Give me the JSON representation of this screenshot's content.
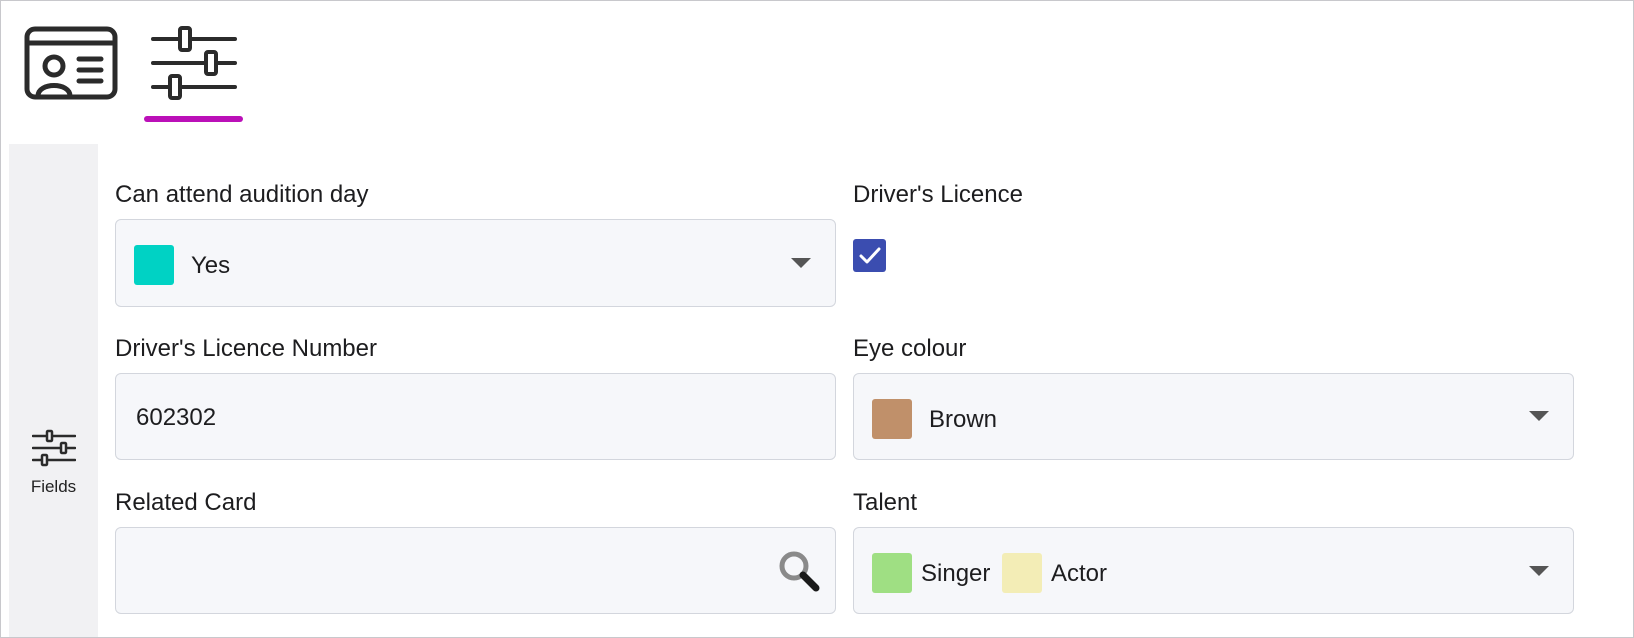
{
  "tabs": [
    {
      "name": "card",
      "icon": "id-card-icon",
      "active": false
    },
    {
      "name": "fields",
      "icon": "sliders-icon",
      "active": true
    }
  ],
  "accent_color": "#bb10b8",
  "rail": {
    "items": [
      {
        "label": "Fields",
        "icon": "sliders-icon"
      }
    ]
  },
  "form": {
    "attend": {
      "label": "Can attend audition day",
      "value": "Yes",
      "swatch_color": "#00d2c4"
    },
    "licence": {
      "label": "Driver's Licence",
      "checked": true,
      "check_color": "#3b4db0"
    },
    "licence_number": {
      "label": "Driver's Licence Number",
      "value": "602302"
    },
    "eye_colour": {
      "label": "Eye colour",
      "value": "Brown",
      "swatch_color": "#c0906a"
    },
    "related_card": {
      "label": "Related Card",
      "value": "",
      "icon": "search-icon"
    },
    "talent": {
      "label": "Talent",
      "values": [
        {
          "label": "Singer",
          "swatch_color": "#9fdf83"
        },
        {
          "label": "Actor",
          "swatch_color": "#f3edb6"
        }
      ]
    }
  }
}
